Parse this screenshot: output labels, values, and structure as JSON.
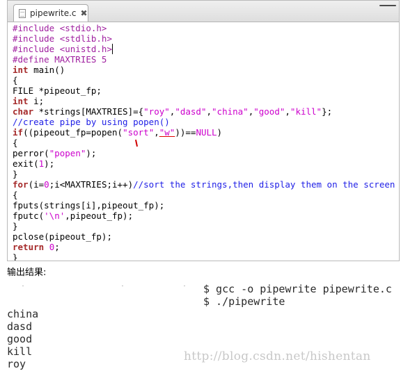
{
  "editor": {
    "tab": {
      "title": "pipewrite.c",
      "close_glyph": "✖"
    },
    "code_lines": [
      [
        {
          "t": "#include <stdio.h>",
          "c": "pp"
        }
      ],
      [
        {
          "t": "#include <stdlib.h>",
          "c": "pp"
        }
      ],
      [
        {
          "t": "#include <unistd.h>",
          "c": "pp"
        },
        {
          "t": "",
          "c": "cur"
        }
      ],
      [
        {
          "t": "#define MAXTRIES 5",
          "c": "pp"
        }
      ],
      [
        {
          "t": "int",
          "c": "kw"
        },
        {
          "t": " main()",
          "c": ""
        }
      ],
      [
        {
          "t": "{",
          "c": ""
        }
      ],
      [
        {
          "t": "FILE *pipeout_fp;",
          "c": ""
        }
      ],
      [
        {
          "t": "int",
          "c": "kw"
        },
        {
          "t": " i;",
          "c": ""
        }
      ],
      [
        {
          "t": "char",
          "c": "kw"
        },
        {
          "t": " *strings[MAXTRIES]={",
          "c": ""
        },
        {
          "t": "\"roy\"",
          "c": "str"
        },
        {
          "t": ",",
          "c": ""
        },
        {
          "t": "\"dasd\"",
          "c": "str"
        },
        {
          "t": ",",
          "c": ""
        },
        {
          "t": "\"china\"",
          "c": "str"
        },
        {
          "t": ",",
          "c": ""
        },
        {
          "t": "\"good\"",
          "c": "str"
        },
        {
          "t": ",",
          "c": ""
        },
        {
          "t": "\"kill\"",
          "c": "str"
        },
        {
          "t": "};",
          "c": ""
        }
      ],
      [
        {
          "t": "//create pipe by using popen()",
          "c": "cm"
        }
      ],
      [
        {
          "t": "if",
          "c": "kw"
        },
        {
          "t": "((pipeout_fp=popen(",
          "c": ""
        },
        {
          "t": "\"sort\"",
          "c": "str"
        },
        {
          "t": ",",
          "c": ""
        },
        {
          "t": "\"w\"",
          "c": "str err"
        },
        {
          "t": "))==",
          "c": ""
        },
        {
          "t": "NULL",
          "c": "str"
        },
        {
          "t": ")",
          "c": ""
        }
      ],
      [
        {
          "t": "{",
          "c": ""
        }
      ],
      [
        {
          "t": "perror(",
          "c": ""
        },
        {
          "t": "\"popen\"",
          "c": "str"
        },
        {
          "t": ");",
          "c": ""
        }
      ],
      [
        {
          "t": "exit(",
          "c": ""
        },
        {
          "t": "1",
          "c": "num"
        },
        {
          "t": ");",
          "c": ""
        }
      ],
      [
        {
          "t": "}",
          "c": ""
        }
      ],
      [
        {
          "t": "for",
          "c": "kw"
        },
        {
          "t": "(i=",
          "c": ""
        },
        {
          "t": "0",
          "c": "num"
        },
        {
          "t": ";i<MAXTRIES;i++)",
          "c": ""
        },
        {
          "t": "//sort the strings,then display them on the screen",
          "c": "cm"
        }
      ],
      [
        {
          "t": "{",
          "c": ""
        }
      ],
      [
        {
          "t": "fputs(strings[i],pipeout_fp);",
          "c": ""
        }
      ],
      [
        {
          "t": "fputc(",
          "c": ""
        },
        {
          "t": "'\\n'",
          "c": "str"
        },
        {
          "t": ",pipeout_fp);",
          "c": ""
        }
      ],
      [
        {
          "t": "}",
          "c": ""
        }
      ],
      [
        {
          "t": "pclose(pipeout_fp);",
          "c": ""
        }
      ],
      [
        {
          "t": "return",
          "c": "kw"
        },
        {
          "t": " ",
          "c": ""
        },
        {
          "t": "0",
          "c": "num"
        },
        {
          "t": ";",
          "c": ""
        }
      ],
      [
        {
          "t": "}",
          "c": ""
        }
      ]
    ]
  },
  "output": {
    "title": "输出结果:",
    "commands": [
      "$ gcc -o pipewrite pipewrite.c",
      "$ ./pipewrite"
    ],
    "results": [
      "china",
      "dasd",
      "good",
      "kill",
      "roy"
    ]
  },
  "watermark": "http://blog.csdn.net/hishentan",
  "colors": {
    "preprocessor": "#a020a0",
    "keyword": "#a52a2a",
    "string": "#cc00cc",
    "comment": "#1e1ee6"
  }
}
